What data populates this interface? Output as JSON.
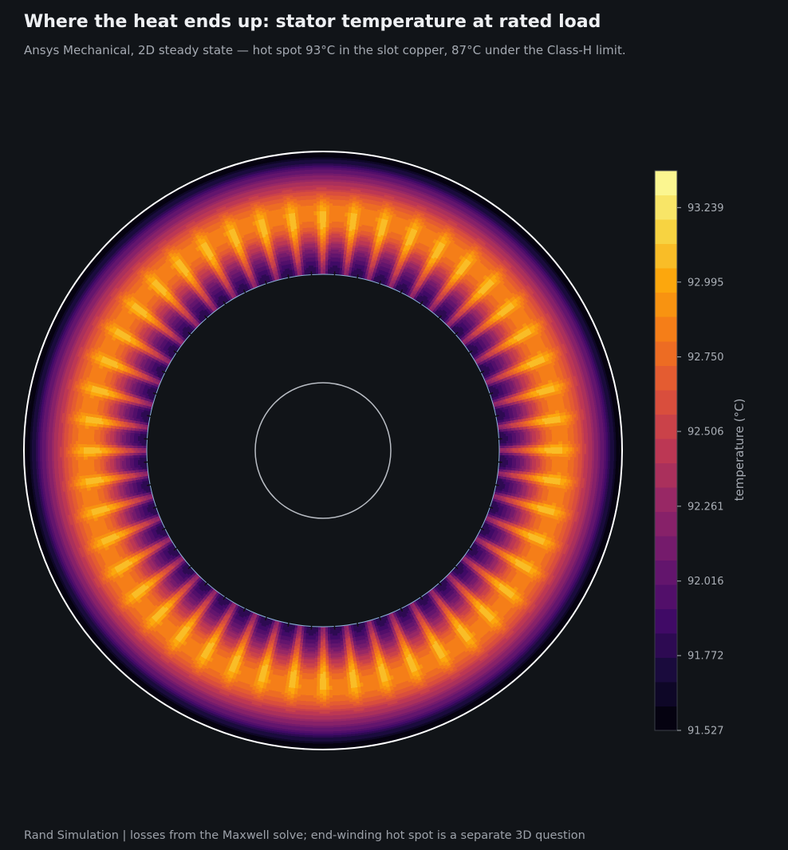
{
  "header": {
    "title": "Where the heat ends up: stator temperature at rated load",
    "subtitle": "Ansys Mechanical, 2D steady state — hot spot 93°C in the slot copper, 87°C under the Class-H limit."
  },
  "footer": {
    "text": "Rand Simulation  |  losses from the Maxwell solve; end-winding hot spot is a separate 3D question"
  },
  "chart_data": {
    "type": "heatmap",
    "plot": "polar filled-contour field of a stator cross-section",
    "colormap": "inferno",
    "colors": {
      "background": "#111418",
      "boundary": "#ffffff",
      "bore_outline": "#8fb4dd",
      "shaft_outline": "#b9bdc4",
      "colorbar_frame": "#3a3f47"
    },
    "slot_count": 48,
    "colorbar": {
      "label": "temperature  (°C)",
      "min": 91.527,
      "max": 93.36,
      "levels": 23,
      "ticks": [
        93.239,
        92.995,
        92.75,
        92.506,
        92.261,
        92.016,
        91.772,
        91.527
      ],
      "tick_labels": [
        "93.239",
        "92.995",
        "92.750",
        "92.506",
        "92.261",
        "92.016",
        "91.772",
        "91.527"
      ]
    }
  }
}
